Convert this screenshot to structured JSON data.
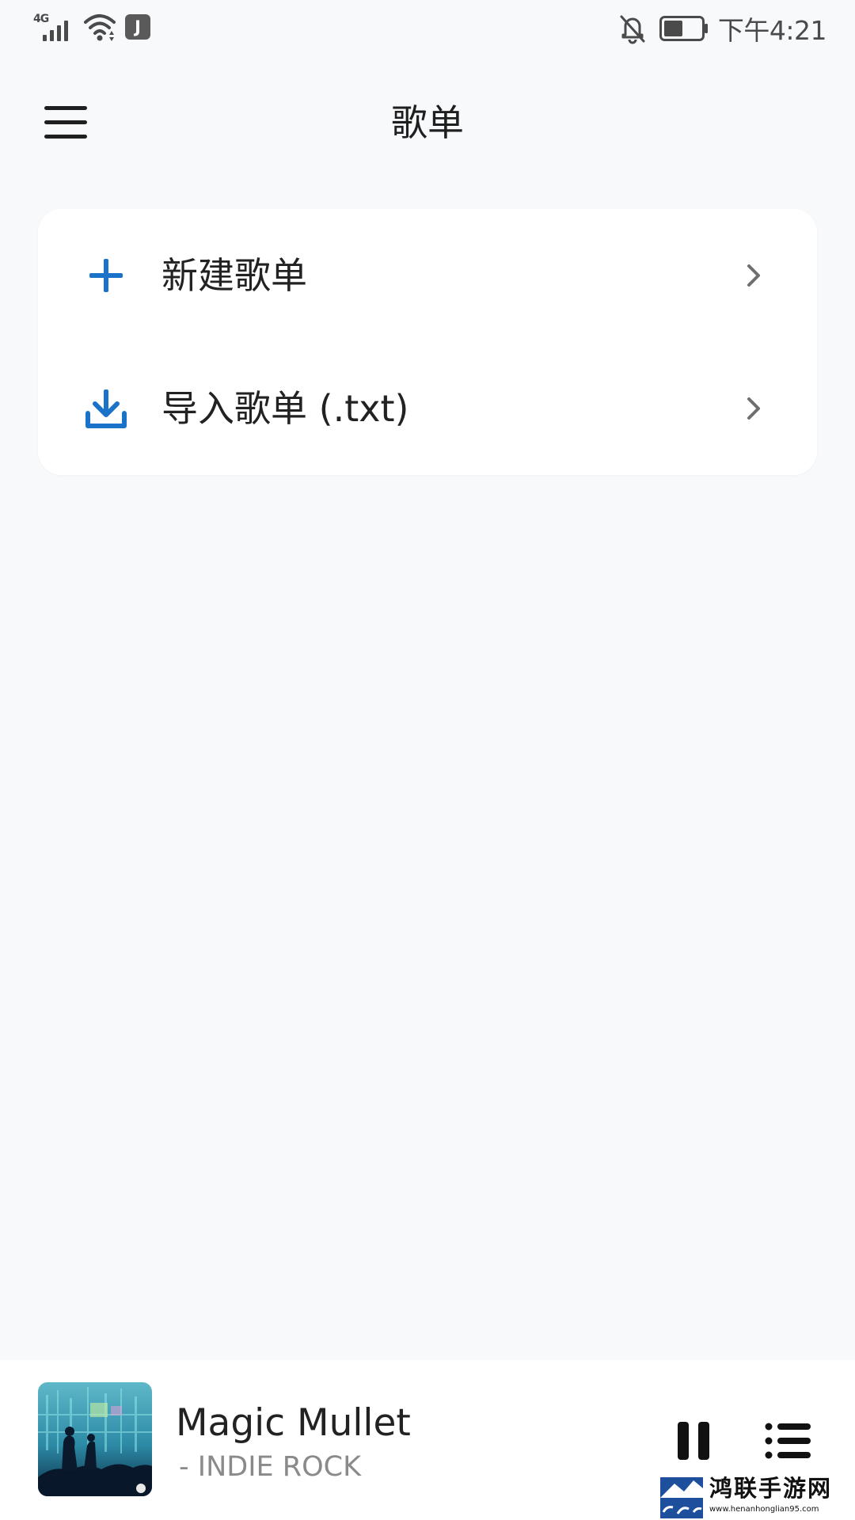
{
  "status_bar": {
    "network": "4G",
    "app_badge": "J",
    "time": "下午4:21",
    "icons": [
      "signal-icon",
      "wifi-icon",
      "app-notification-icon",
      "bell-off-icon",
      "battery-icon"
    ]
  },
  "header": {
    "title": "歌单",
    "menu_icon": "hamburger-menu-icon"
  },
  "actions": [
    {
      "icon": "plus-icon",
      "label": "新建歌单"
    },
    {
      "icon": "download-icon",
      "label": "导入歌单 (.txt)"
    }
  ],
  "now_playing": {
    "title": "Magic Mullet",
    "artist": "- INDIE ROCK",
    "controls": [
      "pause-icon",
      "queue-list-icon"
    ]
  },
  "watermark": {
    "text": "鸿联手游网",
    "url": "www.henanhonglian95.com"
  },
  "colors": {
    "background": "#f8f9fb",
    "card": "#ffffff",
    "accent": "#1a73c9",
    "text": "#222222",
    "secondary_text": "#8a8a8a"
  }
}
